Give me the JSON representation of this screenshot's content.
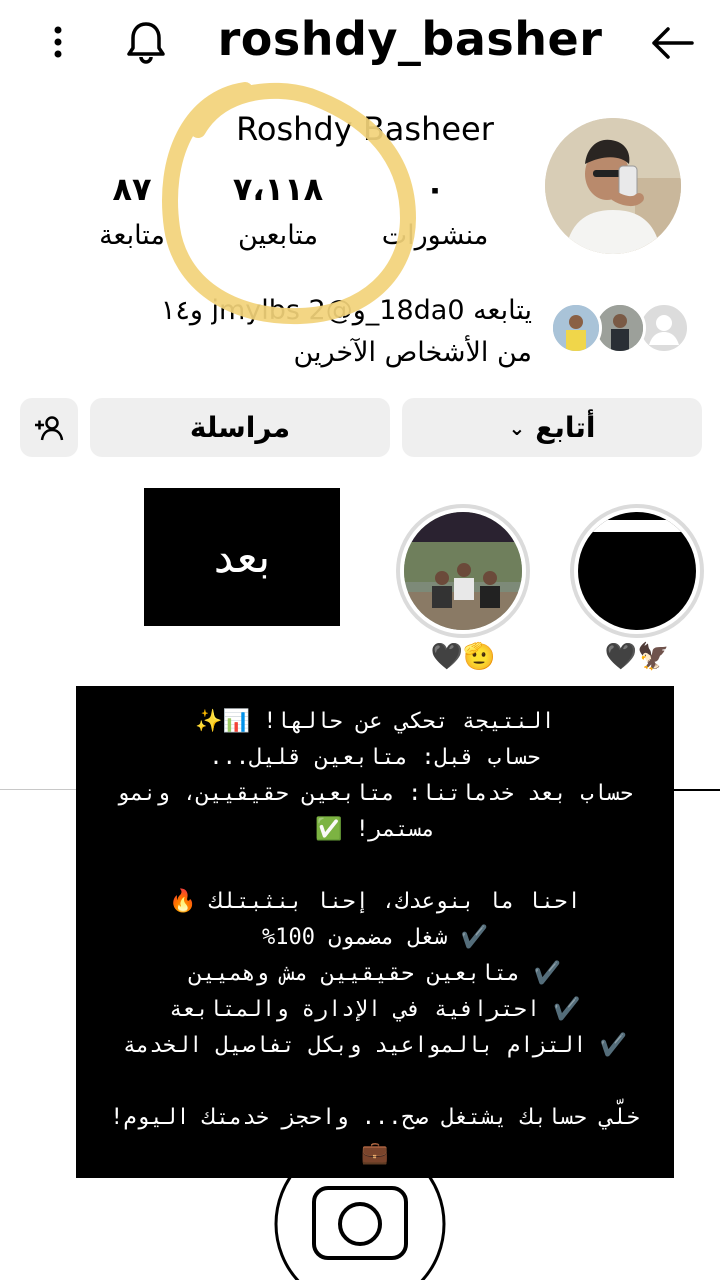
{
  "header": {
    "username": "roshdy_basher",
    "back_icon": "arrow-left-icon",
    "bell_icon": "bell-icon",
    "menu_icon": "more-vertical-icon"
  },
  "profile": {
    "display_name": "Roshdy Basheer",
    "stats": [
      {
        "value": "٠",
        "label": "منشورات"
      },
      {
        "value": "٧،١١٨",
        "label": "متابعين"
      },
      {
        "value": "٨٧",
        "label": "متابعة"
      }
    ],
    "followed_by_line1": "يتابعه 18da0_و@2 jmylbs و١٤",
    "followed_by_line2": "من الأشخاص الآخرين"
  },
  "actions": {
    "follow_label": "أتابع",
    "message_label": "مراسلة",
    "add_person_icon": "add-person-icon"
  },
  "highlights": [
    {
      "label": "🖤🦅"
    },
    {
      "label": "🖤🫡"
    }
  ],
  "after_label": "بعد",
  "promo": {
    "lines": [
      "النتيجة تحكي عن حالها! 📊✨",
      "حساب قبل: متابعين قليل...",
      "حساب بعد خدماتنا: متابعين حقيقيين، ونمو",
      "مستمر! ✅",
      "",
      "احنا ما بنوعدك، إحنا بنثبتلك 🔥",
      "✔️ شغل مضمون 100%",
      "✔️ متابعين حقيقيين مش وهميين",
      "✔️ احترافية في الإدارة والمتابعة",
      "✔️ التزام بالمواعيد وبكل تفاصيل الخدمة",
      "",
      "خلّي حسابك يشتغل صح... واحجز خدمتك اليوم!",
      "💼"
    ]
  },
  "colors": {
    "button_bg": "#efefef",
    "annotation_circle": "#f2d27a"
  }
}
